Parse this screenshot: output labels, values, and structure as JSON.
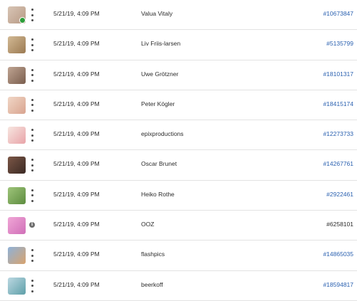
{
  "rows": [
    {
      "date": "5/21/19, 4:09 PM",
      "name": "Valua Vitaly",
      "id": "#10673847",
      "id_link": true,
      "status_icon": "menu",
      "verified": true,
      "thumb": [
        "#d8c5b5",
        "#b89a86"
      ]
    },
    {
      "date": "5/21/19, 4:09 PM",
      "name": "Liv Friis-larsen",
      "id": "#5135799",
      "id_link": true,
      "status_icon": "menu",
      "verified": false,
      "thumb": [
        "#d2b994",
        "#9b7a52"
      ]
    },
    {
      "date": "5/21/19, 4:09 PM",
      "name": "Uwe Grötzner",
      "id": "#18101317",
      "id_link": true,
      "status_icon": "menu",
      "verified": false,
      "thumb": [
        "#bfa492",
        "#7a5e4e"
      ]
    },
    {
      "date": "5/21/19, 4:09 PM",
      "name": "Peter Kögler",
      "id": "#18415174",
      "id_link": true,
      "status_icon": "menu",
      "verified": false,
      "thumb": [
        "#f1d6c6",
        "#d8a48f"
      ]
    },
    {
      "date": "5/21/19, 4:09 PM",
      "name": "epixproductions",
      "id": "#12273733",
      "id_link": true,
      "status_icon": "menu",
      "verified": false,
      "thumb": [
        "#f7e6e0",
        "#e8a3a8"
      ]
    },
    {
      "date": "5/21/19, 4:09 PM",
      "name": "Oscar Brunet",
      "id": "#14267761",
      "id_link": true,
      "status_icon": "menu",
      "verified": false,
      "thumb": [
        "#7b5646",
        "#3b2a24"
      ]
    },
    {
      "date": "5/21/19, 4:09 PM",
      "name": "Heiko Rothe",
      "id": "#2922461",
      "id_link": true,
      "status_icon": "menu",
      "verified": false,
      "thumb": [
        "#9ec47a",
        "#5d8c3f"
      ]
    },
    {
      "date": "5/21/19, 4:09 PM",
      "name": "OOZ",
      "id": "#6258101",
      "id_link": false,
      "status_icon": "info",
      "verified": false,
      "thumb": [
        "#f0a6d6",
        "#d06fb8"
      ]
    },
    {
      "date": "5/21/19, 4:09 PM",
      "name": "flashpics",
      "id": "#14865035",
      "id_link": true,
      "status_icon": "menu",
      "verified": false,
      "thumb": [
        "#8fb2d8",
        "#d8a36e"
      ]
    },
    {
      "date": "5/21/19, 4:09 PM",
      "name": "beerkoff",
      "id": "#18594817",
      "id_link": true,
      "status_icon": "menu",
      "verified": false,
      "thumb": [
        "#bcd8e2",
        "#5e9fa8"
      ]
    }
  ],
  "info_glyph": "i"
}
